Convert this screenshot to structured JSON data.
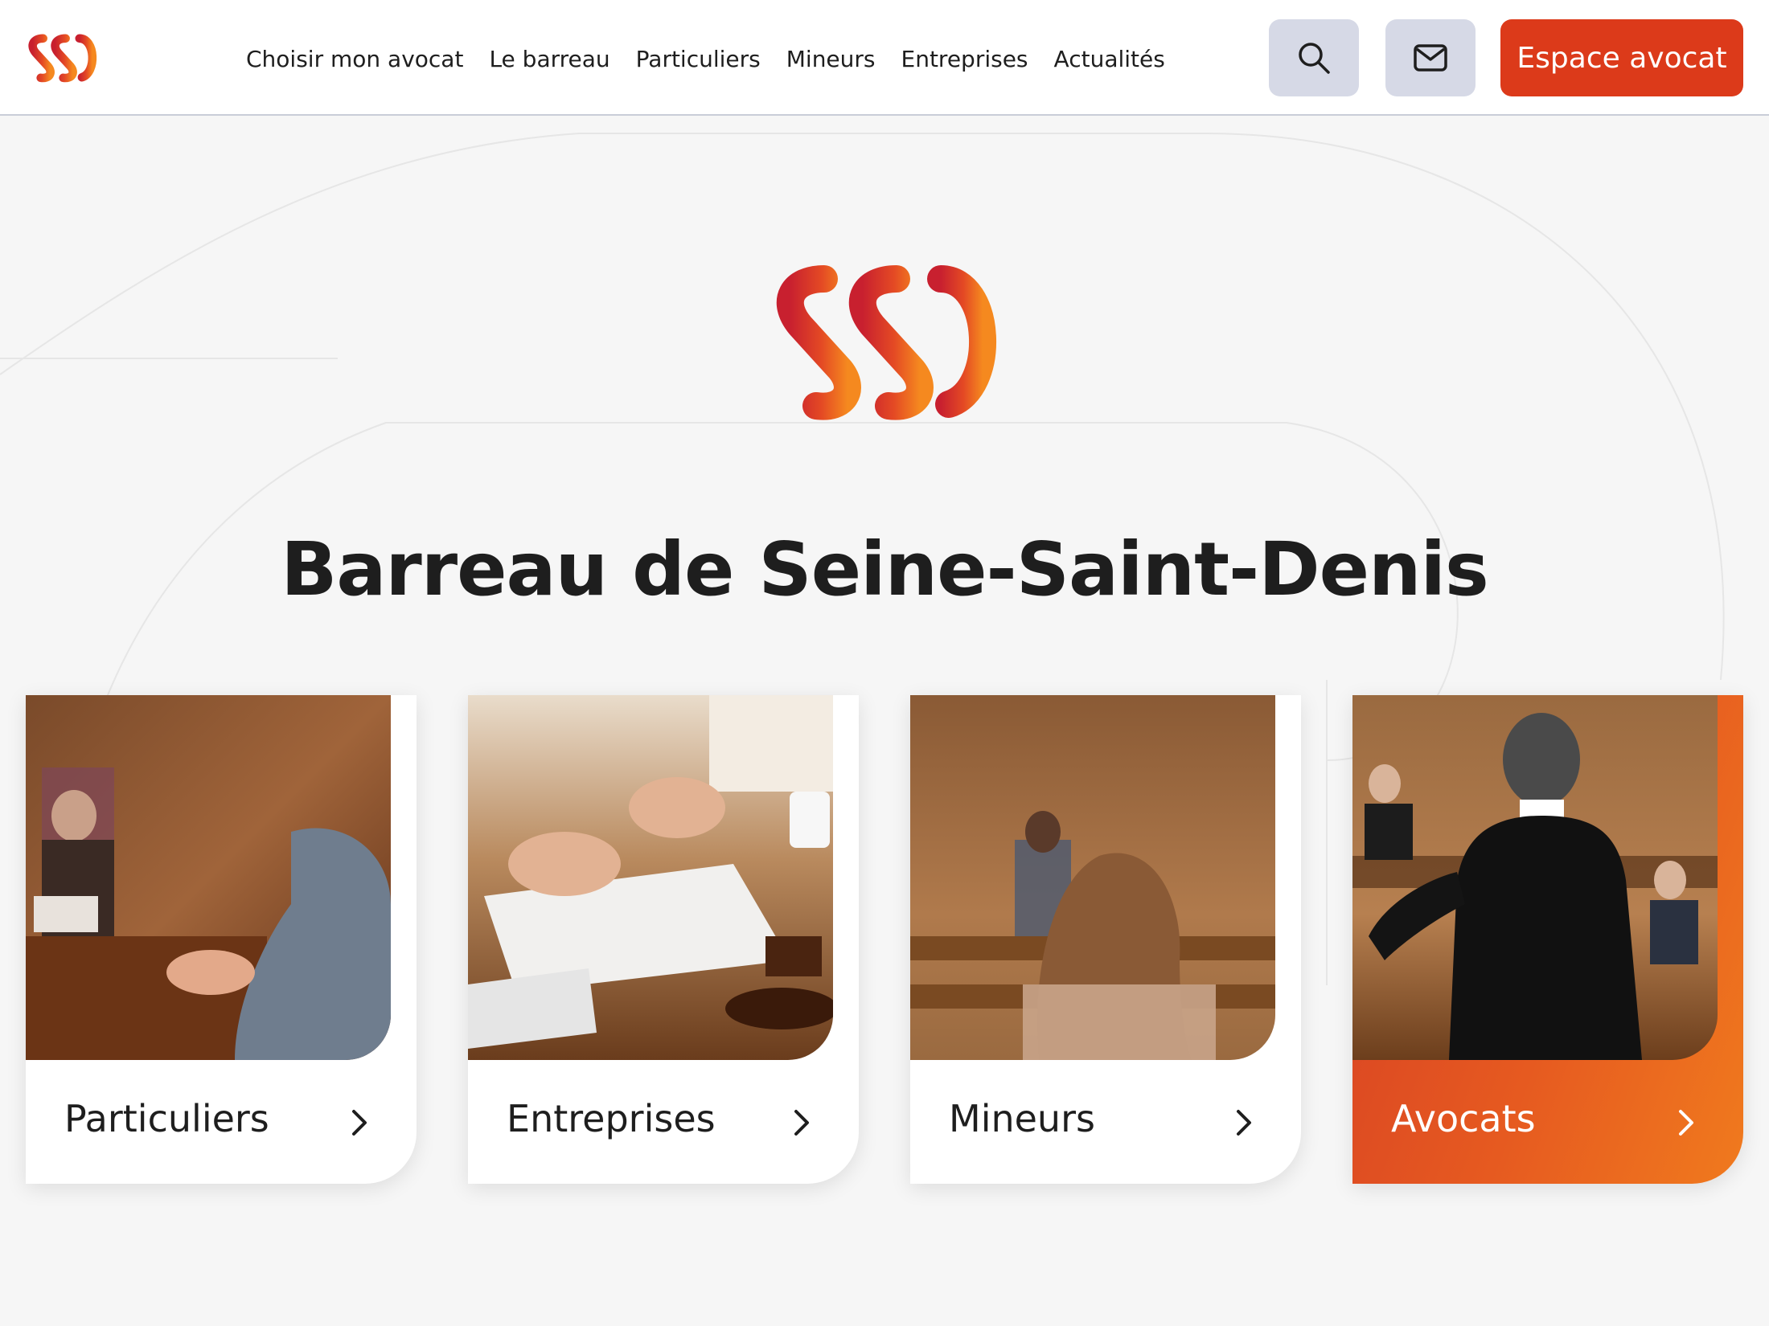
{
  "header": {
    "nav": [
      {
        "label": "Choisir mon avocat"
      },
      {
        "label": "Le barreau"
      },
      {
        "label": "Particuliers"
      },
      {
        "label": "Mineurs"
      },
      {
        "label": "Entreprises"
      },
      {
        "label": "Actualités"
      }
    ],
    "search_icon": "search-icon",
    "mail_icon": "mail-icon",
    "cta_label": "Espace avocat"
  },
  "hero": {
    "logo_letters": "SSD",
    "title": "Barreau de Seine-Saint-Denis"
  },
  "cards": [
    {
      "label": "Particuliers",
      "image": "courtroom-woman-gesturing-photo"
    },
    {
      "label": "Entreprises",
      "image": "contract-signing-gavel-photo"
    },
    {
      "label": "Mineurs",
      "image": "courtroom-girl-seen-from-behind-photo"
    },
    {
      "label": "Avocats",
      "image": "lawyer-in-robe-photo"
    }
  ],
  "colors": {
    "brand_red": "#dc3a1a",
    "brand_orange": "#f07a1e",
    "icon_button_bg": "#d6d9e6",
    "page_bg": "#f6f6f6"
  }
}
